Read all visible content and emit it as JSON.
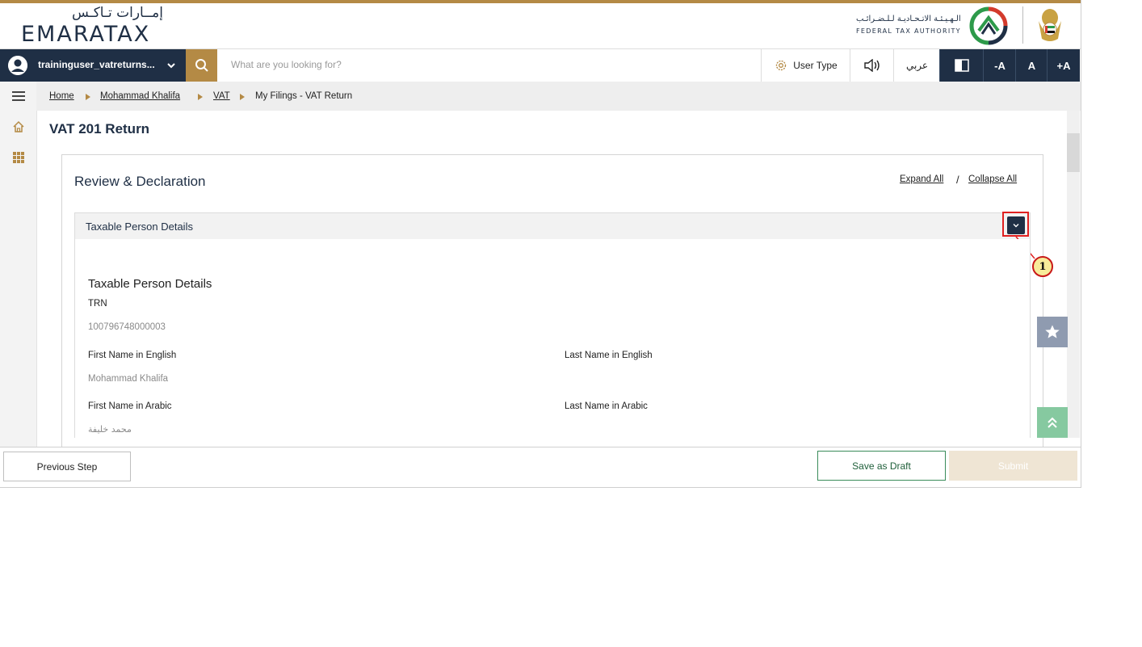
{
  "header": {
    "brand_arabic": "إمــارات تـاكـس",
    "brand_english": "EMARATAX",
    "fta_arabic": "الـهـيـئـة الاتـحـاديـة لـلـضـرائـب",
    "fta_english": "FEDERAL TAX AUTHORITY"
  },
  "toolbar": {
    "username": "traininguser_vatreturns...",
    "search_placeholder": "What are you looking for?",
    "user_type_label": "User Type",
    "arabic_label": "عربي",
    "font_decrease_label": "-A",
    "font_normal_label": "A",
    "font_increase_label": "+A"
  },
  "breadcrumb": {
    "items": [
      "Home",
      "Mohammad Khalifa",
      "VAT",
      "My Filings - VAT Return"
    ]
  },
  "page": {
    "title": "VAT 201 Return",
    "section_title": "Review & Declaration",
    "expand_all": "Expand All",
    "separator": "/",
    "collapse_all": "Collapse All"
  },
  "accordion": {
    "header_title": "Taxable Person Details",
    "body_title": "Taxable Person Details",
    "callout_number": "1",
    "fields": {
      "trn_label": "TRN",
      "trn_value": "100796748000003",
      "first_name_en_label": "First Name in English",
      "first_name_en_value": "Mohammad Khalifa",
      "last_name_en_label": "Last Name in English",
      "first_name_ar_label": "First Name in Arabic",
      "first_name_ar_value": "محمد خليفة",
      "last_name_ar_label": "Last Name in Arabic"
    }
  },
  "footer": {
    "previous_label": "Previous Step",
    "draft_label": "Save as Draft",
    "submit_label": "Submit"
  },
  "colors": {
    "navy": "#1f2f45",
    "gold": "#b48a45",
    "highlight_red": "#e02020",
    "draft_green": "#3a8c5a"
  }
}
